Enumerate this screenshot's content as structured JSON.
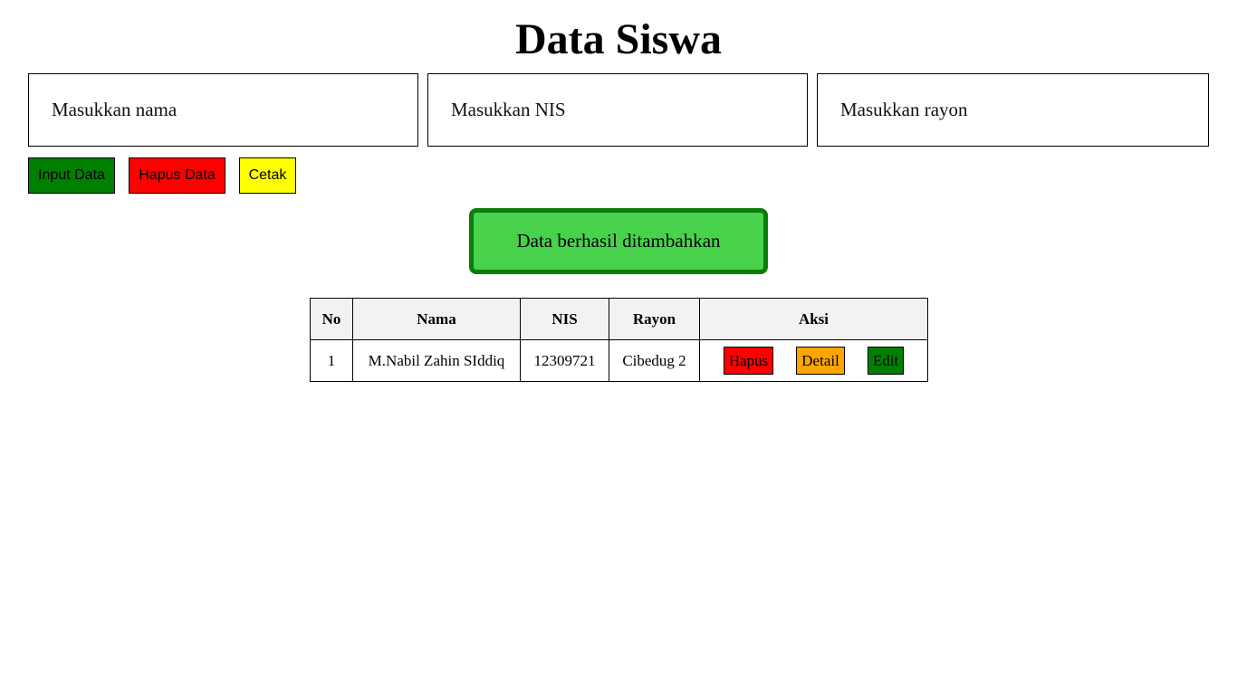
{
  "page": {
    "title": "Data Siswa"
  },
  "form": {
    "nama_placeholder": "Masukkan nama",
    "nis_placeholder": "Masukkan NIS",
    "rayon_placeholder": "Masukkan rayon",
    "nama_value": "",
    "nis_value": "",
    "rayon_value": ""
  },
  "buttons": {
    "input_label": "Input Data",
    "hapus_label": "Hapus Data",
    "cetak_label": "Cetak"
  },
  "alert": {
    "message": "Data berhasil ditambahkan"
  },
  "table": {
    "headers": [
      "No",
      "Nama",
      "NIS",
      "Rayon",
      "Aksi"
    ],
    "rows": [
      {
        "no": "1",
        "nama": "M.Nabil Zahin SIddiq",
        "nis": "12309721",
        "rayon": "Cibedug 2",
        "actions": {
          "hapus": "Hapus",
          "detail": "Detail",
          "edit": "Edit"
        }
      }
    ]
  },
  "colors": {
    "input_button": "#008000",
    "hapus_button": "#ff0000",
    "cetak_button": "#ffff00",
    "alert_background": "#48d24c",
    "alert_border": "#0a7d0a",
    "table_header_background": "#f2f2f2",
    "row_hapus": "#ff0000",
    "row_detail": "#ffa500",
    "row_edit": "#008000"
  }
}
